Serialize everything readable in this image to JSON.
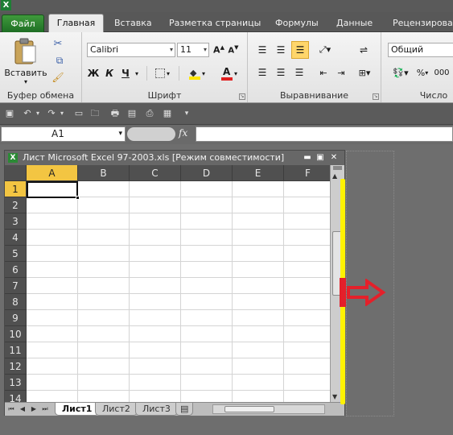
{
  "app": {
    "icon_letter": "X"
  },
  "ribbon_tabs": {
    "file": "Файл",
    "home": "Главная",
    "insert": "Вставка",
    "page_layout": "Разметка страницы",
    "formulas": "Формулы",
    "data": "Данные",
    "review": "Рецензирова"
  },
  "clipboard": {
    "paste_label": "Вставить",
    "group_label": "Буфер обмена"
  },
  "font": {
    "font_name": "Calibri",
    "font_size": "11",
    "bold": "Ж",
    "italic": "К",
    "underline": "Ч",
    "group_label": "Шрифт"
  },
  "alignment": {
    "group_label": "Выравнивание"
  },
  "number": {
    "format": "Общий",
    "group_label": "Число"
  },
  "formula_bar": {
    "name_box": "A1",
    "fx": "fx",
    "formula": ""
  },
  "workbook": {
    "title": "Лист Microsoft Excel 97-2003.xls  [Режим совместимости]",
    "columns": [
      "A",
      "B",
      "C",
      "D",
      "E",
      "F"
    ],
    "rows": [
      "1",
      "2",
      "3",
      "4",
      "5",
      "6",
      "7",
      "8",
      "9",
      "10",
      "11",
      "12",
      "13",
      "14"
    ],
    "active_cell": "A1",
    "sheets": [
      "Лист1",
      "Лист2",
      "Лист3"
    ],
    "active_sheet": "Лист1"
  },
  "annotation_colors": {
    "highlight": "#fff200",
    "arrow": "#e4202a"
  }
}
